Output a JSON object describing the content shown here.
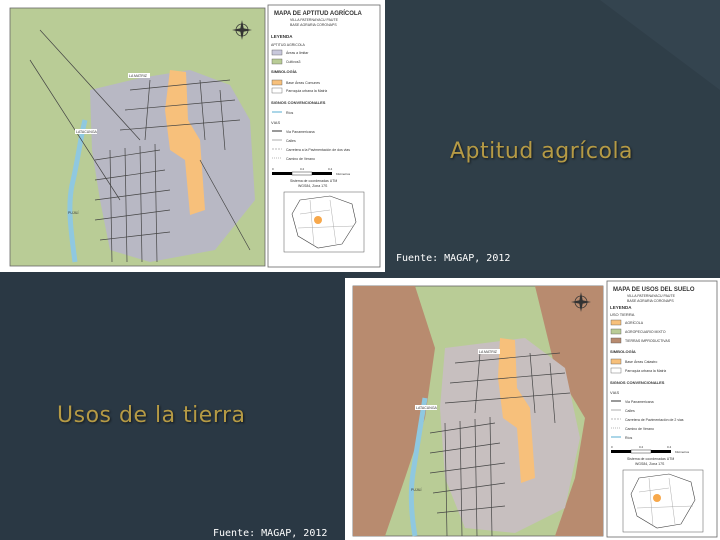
{
  "slide_top": {
    "title": "Aptitud agrícola",
    "source": "Fuente: MAGAP, 2012",
    "map": {
      "title": "MAPA DE APTITUD AGRÍCOLA",
      "subtitle_1": "VILLA PATERNAYACU PAUTE",
      "subtitle_2": "BASE AGRARIA CORONAPS",
      "leyenda_label": "LEYENDA",
      "aptitud_label": "APTITUD AGRICOLA",
      "legend_items": [
        "Áreas a limitar",
        "Cultivos3"
      ],
      "simbologia_label": "SIMBOLOGÍA",
      "simbologia_items": [
        "Base Áreas Comunes",
        "Parroquia urbana la Matriz"
      ],
      "signos_label": "SIGNOS CONVENCIONALES",
      "signos_item": "Ríos",
      "vias_label": "VIAS",
      "vias_items": [
        "Via Panamericana",
        "Calles",
        "Carretera a la Pavimentación de dos vias",
        "Camino de Verano"
      ],
      "scale_labels": [
        "0",
        "0.2",
        "0.4"
      ],
      "scale_unit": "Kilómetros",
      "projection_1": "Sistema de coordenadas UTM",
      "projection_2": "WGS84, Zona 17S",
      "place_labels": [
        "LA MATRIZ",
        "LATACUNGA",
        "PUJILÍ"
      ]
    }
  },
  "slide_bottom": {
    "title": "Usos de la tierra",
    "source": "Fuente: MAGAP, 2012",
    "map": {
      "title": "MAPA DE USOS DEL SUELO",
      "subtitle_1": "VILLA PATERNAYACU PAUTE",
      "subtitle_2": "BASE AGRARIA CORONAPS",
      "leyenda_label": "LEYENDA",
      "usos_label": "USO TIERRA",
      "legend_items": [
        "AGRÍCOLA",
        "AGROPECUARIO MIXTO",
        "TIERRAS IMPRODUCTIVAS"
      ],
      "simbologia_label": "SIMBOLOGÍA",
      "simbologia_items": [
        "Base Áreas Catastro",
        "Parroquia urbana la Matriz"
      ],
      "signos_label": "SIGNOS CONVENCIONALES",
      "vias_label": "VIAS",
      "vias_items": [
        "Via Panamericana",
        "Calles",
        "Carretera de Pavimentación de 2 vias",
        "Camino de Verano"
      ],
      "signos_item": "Ríos",
      "scale_labels": [
        "0",
        "0.2",
        "0.4"
      ],
      "scale_unit": "Kilómetros",
      "projection_1": "Sistema de coordenadas UTM",
      "projection_2": "WGS84, Zona 17S",
      "place_labels": [
        "LA MATRIZ",
        "LATACUNGA",
        "PUJILÍ"
      ]
    }
  },
  "colors": {
    "background": "#2c3a45",
    "title_gold": "#b59a45",
    "map_green": "#b9cc96",
    "map_gray": "#b8b8c4",
    "map_orange": "#f7c07b",
    "map_brown": "#b88b6f",
    "river_blue": "#8fc8e0"
  }
}
